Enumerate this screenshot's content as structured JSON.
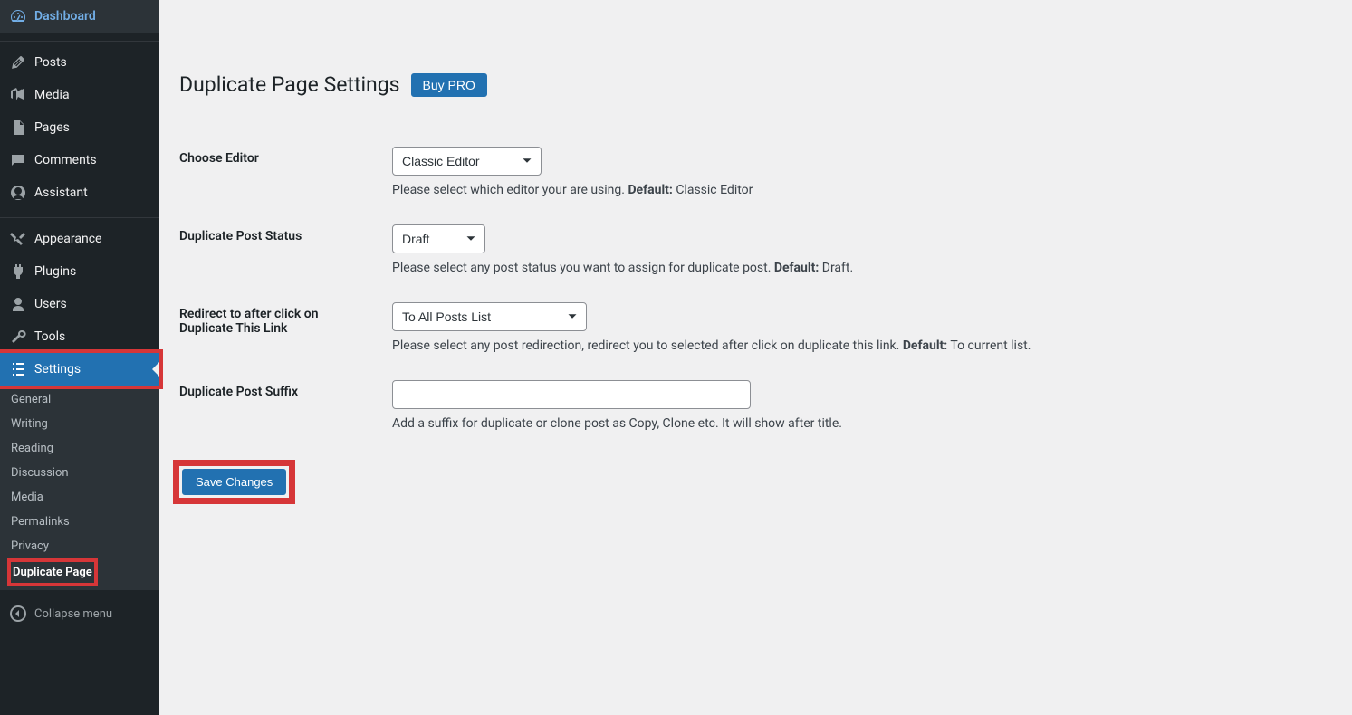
{
  "sidebar": {
    "items": [
      {
        "label": "Dashboard",
        "icon": "dashboard-icon",
        "current": true
      },
      {
        "label": "Posts",
        "icon": "posts-icon"
      },
      {
        "label": "Media",
        "icon": "media-icon"
      },
      {
        "label": "Pages",
        "icon": "pages-icon"
      },
      {
        "label": "Comments",
        "icon": "comments-icon"
      },
      {
        "label": "Assistant",
        "icon": "assistant-icon"
      },
      {
        "label": "Appearance",
        "icon": "appearance-icon"
      },
      {
        "label": "Plugins",
        "icon": "plugins-icon"
      },
      {
        "label": "Users",
        "icon": "users-icon"
      },
      {
        "label": "Tools",
        "icon": "tools-icon"
      },
      {
        "label": "Settings",
        "icon": "settings-icon",
        "active": true,
        "highlight": true
      }
    ],
    "sub_items": [
      {
        "label": "General"
      },
      {
        "label": "Writing"
      },
      {
        "label": "Reading"
      },
      {
        "label": "Discussion"
      },
      {
        "label": "Media"
      },
      {
        "label": "Permalinks"
      },
      {
        "label": "Privacy"
      },
      {
        "label": "Duplicate Page",
        "active": true,
        "highlight": true
      }
    ],
    "collapse_label": "Collapse menu"
  },
  "page": {
    "title": "Duplicate Page Settings",
    "buy_pro_label": "Buy PRO"
  },
  "form": {
    "editor": {
      "label": "Choose Editor",
      "value": "Classic Editor",
      "desc_prefix": "Please select which editor your are using. ",
      "desc_bold": "Default:",
      "desc_suffix": " Classic Editor"
    },
    "status": {
      "label": "Duplicate Post Status",
      "value": "Draft",
      "desc_prefix": "Please select any post status you want to assign for duplicate post. ",
      "desc_bold": "Default:",
      "desc_suffix": " Draft."
    },
    "redirect": {
      "label": "Redirect to after click on Duplicate This Link",
      "value": "To All Posts List",
      "desc_prefix": "Please select any post redirection, redirect you to selected after click on duplicate this link. ",
      "desc_bold": "Default:",
      "desc_suffix": " To current list."
    },
    "suffix": {
      "label": "Duplicate Post Suffix",
      "value": "",
      "desc": "Add a suffix for duplicate or clone post as Copy, Clone etc. It will show after title."
    },
    "save_label": "Save Changes"
  }
}
